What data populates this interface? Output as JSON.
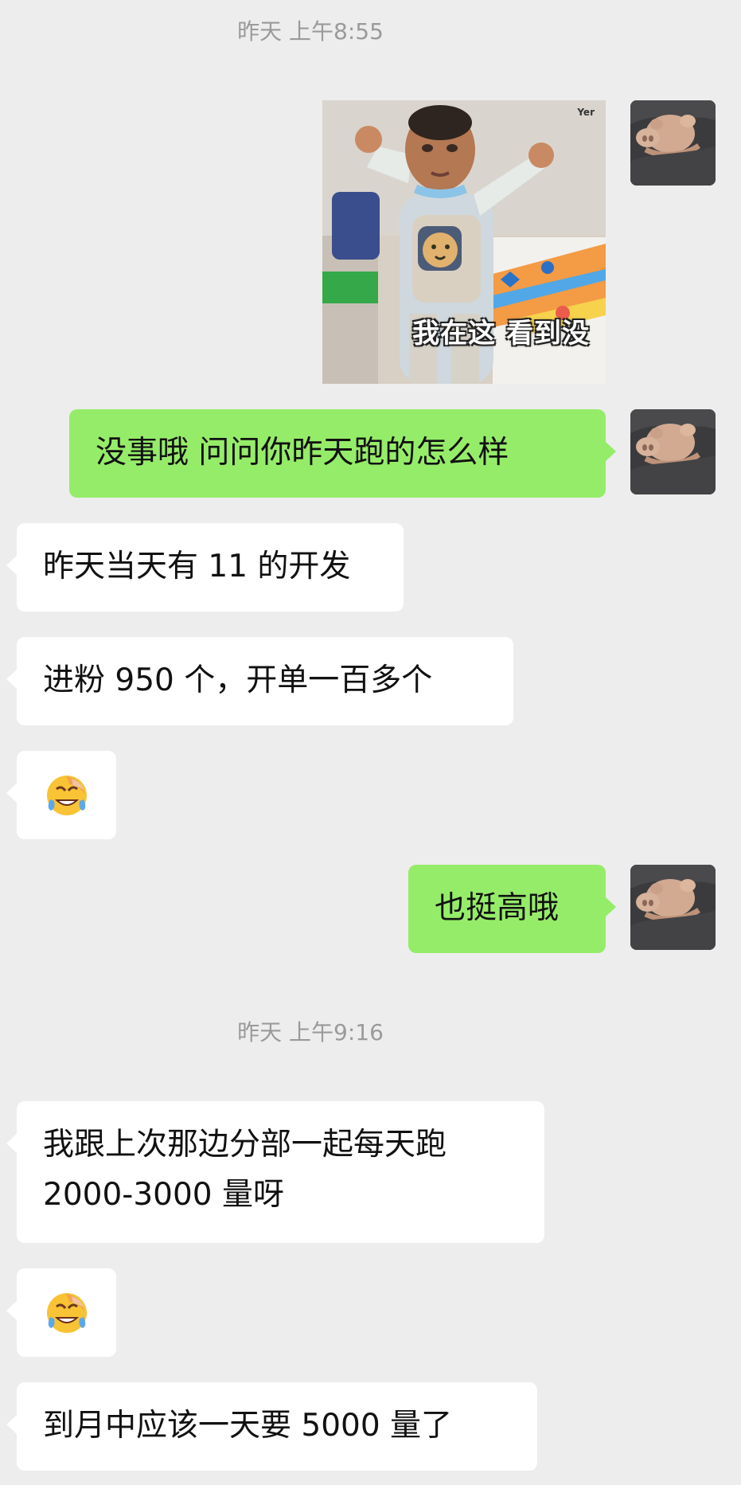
{
  "chat": {
    "timestamps": [
      "昨天 上午8:55",
      "昨天 上午9:16"
    ],
    "messages": [
      {
        "side": "right",
        "type": "sticker",
        "caption": "我在这 看到没",
        "watermark": "Yer"
      },
      {
        "side": "right",
        "type": "text",
        "text": "没事哦 问问你昨天跑的怎么样"
      },
      {
        "side": "left",
        "type": "text",
        "text": "昨天当天有 11 的开发"
      },
      {
        "side": "left",
        "type": "text",
        "text": "进粉 950 个，开单一百多个"
      },
      {
        "side": "left",
        "type": "emoji",
        "emoji": "crying-laughing-face"
      },
      {
        "side": "right",
        "type": "text",
        "text": "也挺高哦"
      },
      {
        "side": "left",
        "type": "text",
        "line1": "我跟上次那边分部一起每天跑",
        "line2": "2000-3000 量呀"
      },
      {
        "side": "left",
        "type": "emoji",
        "emoji": "crying-laughing-face"
      },
      {
        "side": "left",
        "type": "text",
        "text": "到月中应该一天要 5000 量了"
      }
    ]
  },
  "colors": {
    "background": "#ededed",
    "sent_bubble": "#95ec69",
    "received_bubble": "#ffffff",
    "timestamp": "#9a9a9a"
  },
  "icons": {
    "avatar": "plush-pig-avatar",
    "emoji": "crying-laughing-face"
  }
}
